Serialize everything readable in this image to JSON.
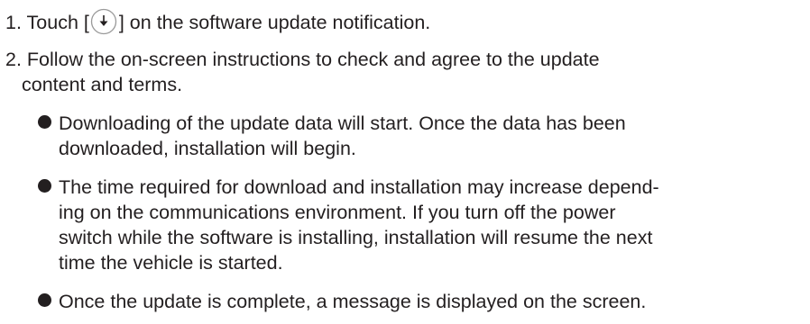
{
  "steps": [
    {
      "number": "1.",
      "text_before": "Touch [",
      "icon": "download-circle-icon",
      "text_after": "] on the software update notification."
    },
    {
      "number": "2.",
      "line1": "Follow the on-screen instructions to check and agree to the update",
      "line2": "content and terms."
    }
  ],
  "bullets": [
    {
      "lines": [
        "Downloading of the update data will start. Once the data has been",
        "downloaded, installation will begin."
      ]
    },
    {
      "lines": [
        "The time required for download and installation may increase depend-",
        "ing on the communications environment. If you turn off the power",
        "switch while the software is installing, installation will resume the next",
        "time the vehicle is started."
      ]
    },
    {
      "lines": [
        "Once the update is complete, a message is displayed on the screen."
      ]
    }
  ]
}
